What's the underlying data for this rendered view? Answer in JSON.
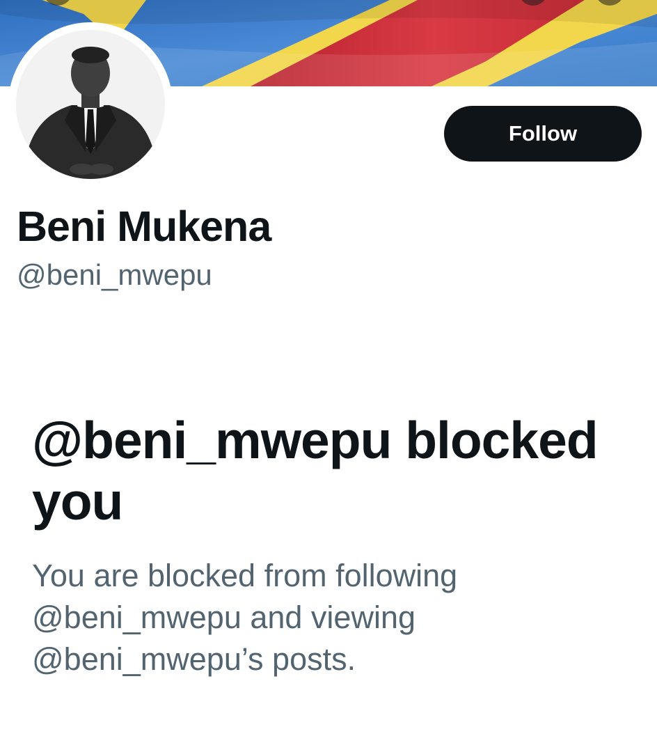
{
  "profile": {
    "display_name": "Beni Mukena",
    "handle": "@beni_mwepu",
    "follow_label": "Follow"
  },
  "blocked": {
    "title": "@beni_mwepu blocked you",
    "description": "You are blocked from following @beni_mwepu and viewing @beni_mwepu’s posts."
  },
  "colors": {
    "primary_text": "#0f1419",
    "secondary_text": "#536471",
    "button_bg": "#0f1419",
    "flag_blue": "#3d7fc9",
    "flag_yellow": "#f2d64b",
    "flag_red": "#cf2f3a"
  },
  "icons": {
    "banner": "flag-banner",
    "avatar": "profile-photo"
  }
}
